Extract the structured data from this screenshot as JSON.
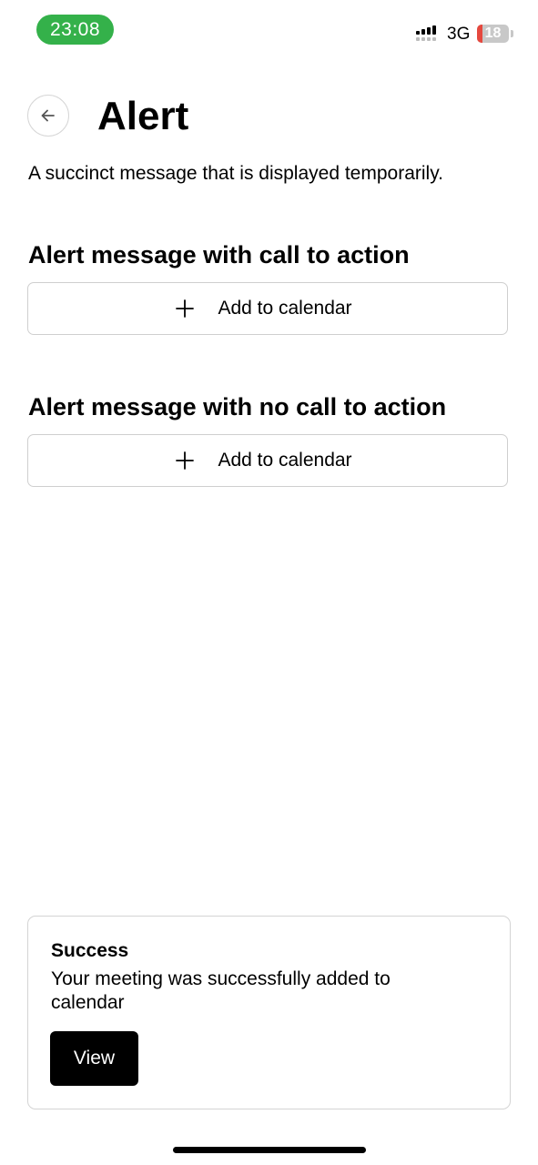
{
  "status_bar": {
    "time": "23:08",
    "network": "3G",
    "battery_level": "18",
    "battery_fraction": 0.18,
    "time_pill_color": "#34b14a",
    "signal_icon": "cellular-signal-icon",
    "battery_icon": "battery-icon"
  },
  "header": {
    "back_icon": "arrow-left-icon",
    "title": "Alert",
    "description": "A succinct message that is displayed temporarily."
  },
  "sections": [
    {
      "title": "Alert message with call to action",
      "button": {
        "icon": "plus-icon",
        "label": "Add to calendar"
      }
    },
    {
      "title": "Alert message with no call to action",
      "button": {
        "icon": "plus-icon",
        "label": "Add to calendar"
      }
    }
  ],
  "alert": {
    "title": "Success",
    "message": "Your meeting was successfully added to calendar",
    "action_label": "View"
  }
}
